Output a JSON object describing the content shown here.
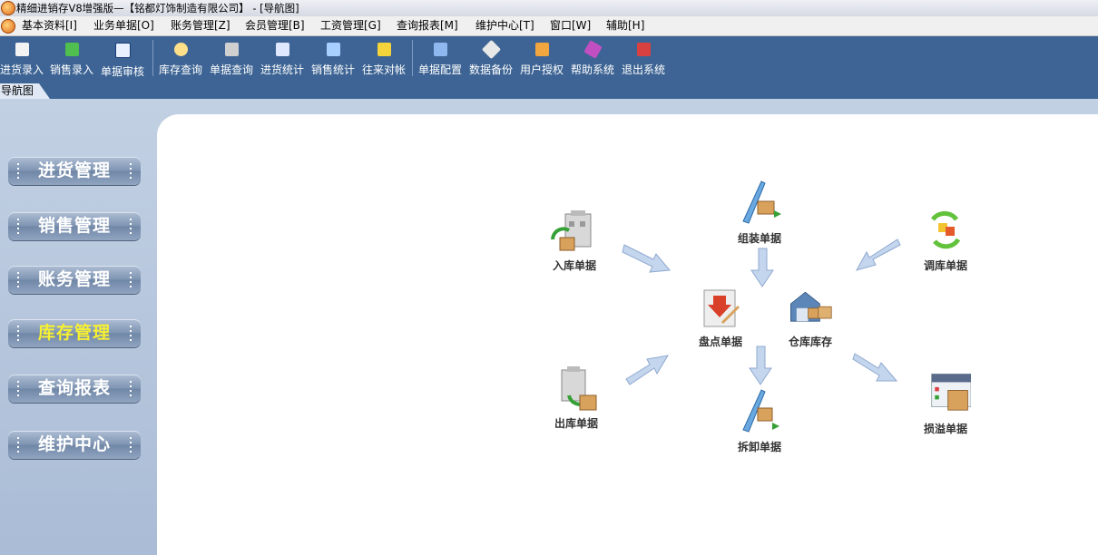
{
  "window": {
    "title": "精细进销存V8增强版—【铭都灯饰制造有限公司】 - [导航图]"
  },
  "menu": [
    "基本资料[I]",
    "业务单据[O]",
    "账务管理[Z]",
    "会员管理[B]",
    "工资管理[G]",
    "查询报表[M]",
    "维护中心[T]",
    "窗口[W]",
    "辅助[H]"
  ],
  "toolbar": [
    {
      "label": "进货录入",
      "icon": "purchase-entry-icon",
      "color": "#f3f3f3"
    },
    {
      "label": "销售录入",
      "icon": "sales-entry-icon",
      "color": "#4fbf4f"
    },
    {
      "label": "单据审核",
      "icon": "check-icon",
      "color": "#e9f0ff"
    },
    {
      "label": "库存查询",
      "icon": "magnifier-icon",
      "color": "#ffe08a"
    },
    {
      "label": "单据查询",
      "icon": "document-search-icon",
      "color": "#d0d0d0"
    },
    {
      "label": "进货统计",
      "icon": "stats-in-icon",
      "color": "#e0e8ff"
    },
    {
      "label": "销售统计",
      "icon": "stats-out-icon",
      "color": "#a8d0ff"
    },
    {
      "label": "往来对帐",
      "icon": "reconcile-icon",
      "color": "#f5d33a"
    },
    {
      "label": "单据配置",
      "icon": "config-icon",
      "color": "#8fb8f0"
    },
    {
      "label": "数据备份",
      "icon": "backup-icon",
      "color": "#e8e8e8"
    },
    {
      "label": "用户授权",
      "icon": "users-icon",
      "color": "#f2a640"
    },
    {
      "label": "帮助系统",
      "icon": "help-book-icon",
      "color": "#c24fc2"
    },
    {
      "label": "退出系统",
      "icon": "exit-icon",
      "color": "#d94040"
    }
  ],
  "tab": {
    "label": "导航图"
  },
  "sidebar": {
    "items": [
      {
        "label": "进货管理",
        "active": false
      },
      {
        "label": "销售管理",
        "active": false
      },
      {
        "label": "账务管理",
        "active": false
      },
      {
        "label": "库存管理",
        "active": true
      },
      {
        "label": "查询报表",
        "active": false
      },
      {
        "label": "维护中心",
        "active": false
      }
    ]
  },
  "flow": {
    "inbound": "入库单据",
    "assemble": "组装单据",
    "transfer": "调库单据",
    "stocktake": "盘点单据",
    "warehouse": "仓库库存",
    "outbound": "出库单据",
    "disassemble": "拆卸单据",
    "loss": "损溢单据"
  },
  "colors": {
    "toolbar_bg": "#3d6494",
    "active_text": "#f7f032"
  }
}
